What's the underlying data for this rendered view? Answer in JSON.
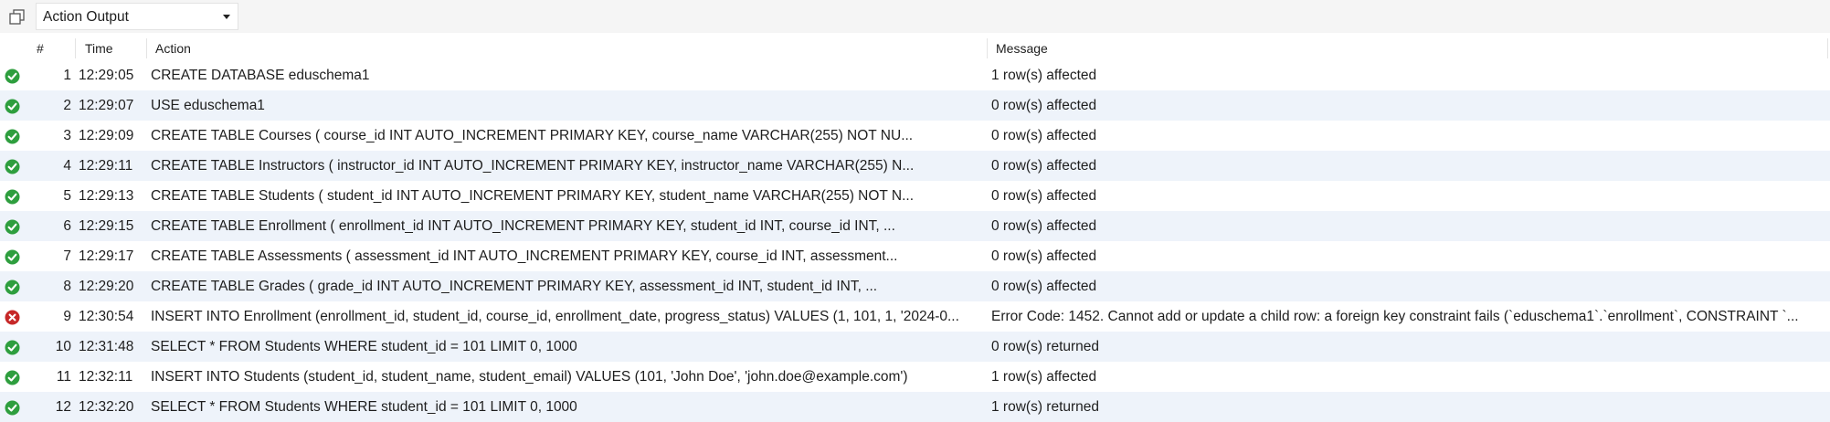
{
  "toolbar": {
    "output_selector": "Action Output"
  },
  "table": {
    "columns": {
      "num": "#",
      "time": "Time",
      "action": "Action",
      "message": "Message"
    },
    "rows": [
      {
        "status": "success",
        "num": "1",
        "time": "12:29:05",
        "action": "CREATE DATABASE eduschema1",
        "message": "1 row(s) affected"
      },
      {
        "status": "success",
        "num": "2",
        "time": "12:29:07",
        "action": "USE eduschema1",
        "message": "0 row(s) affected"
      },
      {
        "status": "success",
        "num": "3",
        "time": "12:29:09",
        "action": "CREATE TABLE Courses (     course_id INT AUTO_INCREMENT PRIMARY KEY,     course_name VARCHAR(255) NOT NU...",
        "message": "0 row(s) affected"
      },
      {
        "status": "success",
        "num": "4",
        "time": "12:29:11",
        "action": "CREATE TABLE Instructors (     instructor_id INT AUTO_INCREMENT PRIMARY KEY,     instructor_name VARCHAR(255) N...",
        "message": "0 row(s) affected"
      },
      {
        "status": "success",
        "num": "5",
        "time": "12:29:13",
        "action": "CREATE TABLE Students (     student_id INT AUTO_INCREMENT PRIMARY KEY,     student_name VARCHAR(255) NOT N...",
        "message": "0 row(s) affected"
      },
      {
        "status": "success",
        "num": "6",
        "time": "12:29:15",
        "action": "CREATE TABLE Enrollment (     enrollment_id INT AUTO_INCREMENT PRIMARY KEY,     student_id INT,     course_id INT, ...",
        "message": "0 row(s) affected"
      },
      {
        "status": "success",
        "num": "7",
        "time": "12:29:17",
        "action": "CREATE TABLE Assessments (     assessment_id INT AUTO_INCREMENT PRIMARY KEY,     course_id INT,     assessment...",
        "message": "0 row(s) affected"
      },
      {
        "status": "success",
        "num": "8",
        "time": "12:29:20",
        "action": "CREATE TABLE Grades (     grade_id INT AUTO_INCREMENT PRIMARY KEY,     assessment_id INT,     student_id INT,     ...",
        "message": "0 row(s) affected"
      },
      {
        "status": "error",
        "num": "9",
        "time": "12:30:54",
        "action": "INSERT INTO Enrollment (enrollment_id, student_id, course_id, enrollment_date, progress_status) VALUES (1, 101, 1, '2024-0...",
        "message": "Error Code: 1452. Cannot add or update a child row: a foreign key constraint fails (`eduschema1`.`enrollment`, CONSTRAINT `..."
      },
      {
        "status": "success",
        "num": "10",
        "time": "12:31:48",
        "action": "SELECT * FROM Students WHERE student_id = 101 LIMIT 0, 1000",
        "message": "0 row(s) returned"
      },
      {
        "status": "success",
        "num": "11",
        "time": "12:32:11",
        "action": "INSERT INTO Students (student_id, student_name, student_email) VALUES (101, 'John Doe', 'john.doe@example.com')",
        "message": "1 row(s) affected"
      },
      {
        "status": "success",
        "num": "12",
        "time": "12:32:20",
        "action": "SELECT * FROM Students WHERE student_id = 101 LIMIT 0, 1000",
        "message": "1 row(s) returned"
      }
    ]
  },
  "colors": {
    "success": "#2e9e3e",
    "error": "#c62828",
    "row_alt": "#eef3fa"
  }
}
